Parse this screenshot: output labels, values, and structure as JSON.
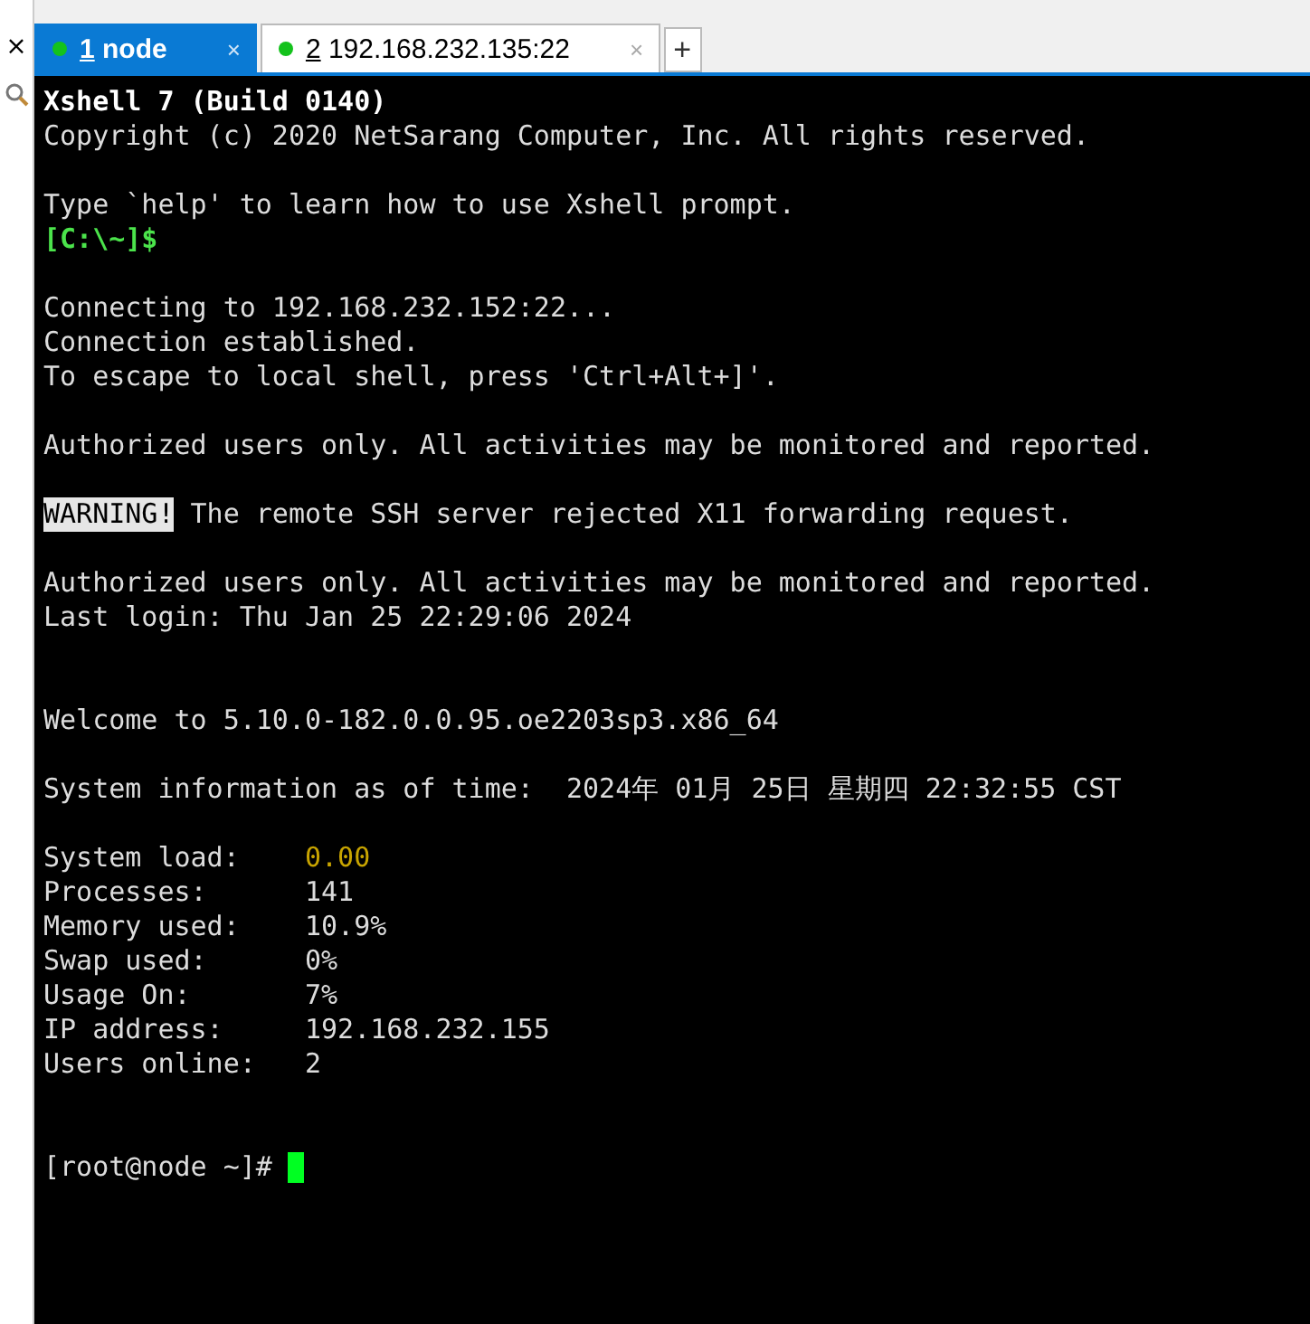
{
  "side_close": "×",
  "tabs": [
    {
      "number": "1",
      "label": "node",
      "selected": true,
      "connected": true,
      "close": "×"
    },
    {
      "number": "2",
      "label": "192.168.232.135:22",
      "selected": false,
      "connected": true,
      "close": "×"
    }
  ],
  "new_tab": "+",
  "terminal": {
    "lines": [
      {
        "kind": "text",
        "segments": [
          {
            "text": "Xshell 7 (Build 0140)",
            "kind": "bold"
          }
        ]
      },
      {
        "kind": "text",
        "segments": [
          {
            "text": "Copyright (c) 2020 NetSarang Computer, Inc. All rights reserved.",
            "kind": "plain"
          }
        ]
      },
      {
        "kind": "blank"
      },
      {
        "kind": "text",
        "segments": [
          {
            "text": "Type `help' to learn how to use Xshell prompt.",
            "kind": "plain"
          }
        ]
      },
      {
        "kind": "text",
        "segments": [
          {
            "text": "[C:\\~]$",
            "kind": "prompt"
          }
        ]
      },
      {
        "kind": "blank"
      },
      {
        "kind": "text",
        "segments": [
          {
            "text": "Connecting to 192.168.232.152:22...",
            "kind": "plain"
          }
        ]
      },
      {
        "kind": "text",
        "segments": [
          {
            "text": "Connection established.",
            "kind": "plain"
          }
        ]
      },
      {
        "kind": "text",
        "segments": [
          {
            "text": "To escape to local shell, press 'Ctrl+Alt+]'.",
            "kind": "plain"
          }
        ]
      },
      {
        "kind": "blank"
      },
      {
        "kind": "text",
        "segments": [
          {
            "text": "Authorized users only. All activities may be monitored and reported.",
            "kind": "plain"
          }
        ]
      },
      {
        "kind": "blank"
      },
      {
        "kind": "text",
        "segments": [
          {
            "text": "WARNING!",
            "kind": "highlight"
          },
          {
            "text": " The remote SSH server rejected X11 forwarding request.",
            "kind": "plain"
          }
        ]
      },
      {
        "kind": "blank"
      },
      {
        "kind": "text",
        "segments": [
          {
            "text": "Authorized users only. All activities may be monitored and reported.",
            "kind": "plain"
          }
        ]
      },
      {
        "kind": "text",
        "segments": [
          {
            "text": "Last login: Thu Jan 25 22:29:06 2024",
            "kind": "plain"
          }
        ]
      },
      {
        "kind": "blank"
      },
      {
        "kind": "blank"
      },
      {
        "kind": "text",
        "segments": [
          {
            "text": "Welcome to 5.10.0-182.0.0.95.oe2203sp3.x86_64",
            "kind": "plain"
          }
        ]
      },
      {
        "kind": "blank"
      },
      {
        "kind": "text",
        "segments": [
          {
            "text": "System information as of time:  2024年 01月 25日 星期四 22:32:55 CST",
            "kind": "plain"
          }
        ]
      },
      {
        "kind": "blank"
      },
      {
        "kind": "text",
        "segments": [
          {
            "text": "System load:    ",
            "kind": "plain"
          },
          {
            "text": "0.00",
            "kind": "warn"
          }
        ]
      },
      {
        "kind": "text",
        "segments": [
          {
            "text": "Processes:      141",
            "kind": "plain"
          }
        ]
      },
      {
        "kind": "text",
        "segments": [
          {
            "text": "Memory used:    10.9%",
            "kind": "plain"
          }
        ]
      },
      {
        "kind": "text",
        "segments": [
          {
            "text": "Swap used:      0%",
            "kind": "plain"
          }
        ]
      },
      {
        "kind": "text",
        "segments": [
          {
            "text": "Usage On:       7%",
            "kind": "plain"
          }
        ]
      },
      {
        "kind": "text",
        "segments": [
          {
            "text": "IP address:     192.168.232.155",
            "kind": "plain"
          }
        ]
      },
      {
        "kind": "text",
        "segments": [
          {
            "text": "Users online:   2",
            "kind": "plain"
          }
        ]
      },
      {
        "kind": "blank"
      },
      {
        "kind": "blank"
      },
      {
        "kind": "text",
        "segments": [
          {
            "text": "[root@node ~]# ",
            "kind": "plain"
          }
        ],
        "cursor": true
      }
    ]
  }
}
